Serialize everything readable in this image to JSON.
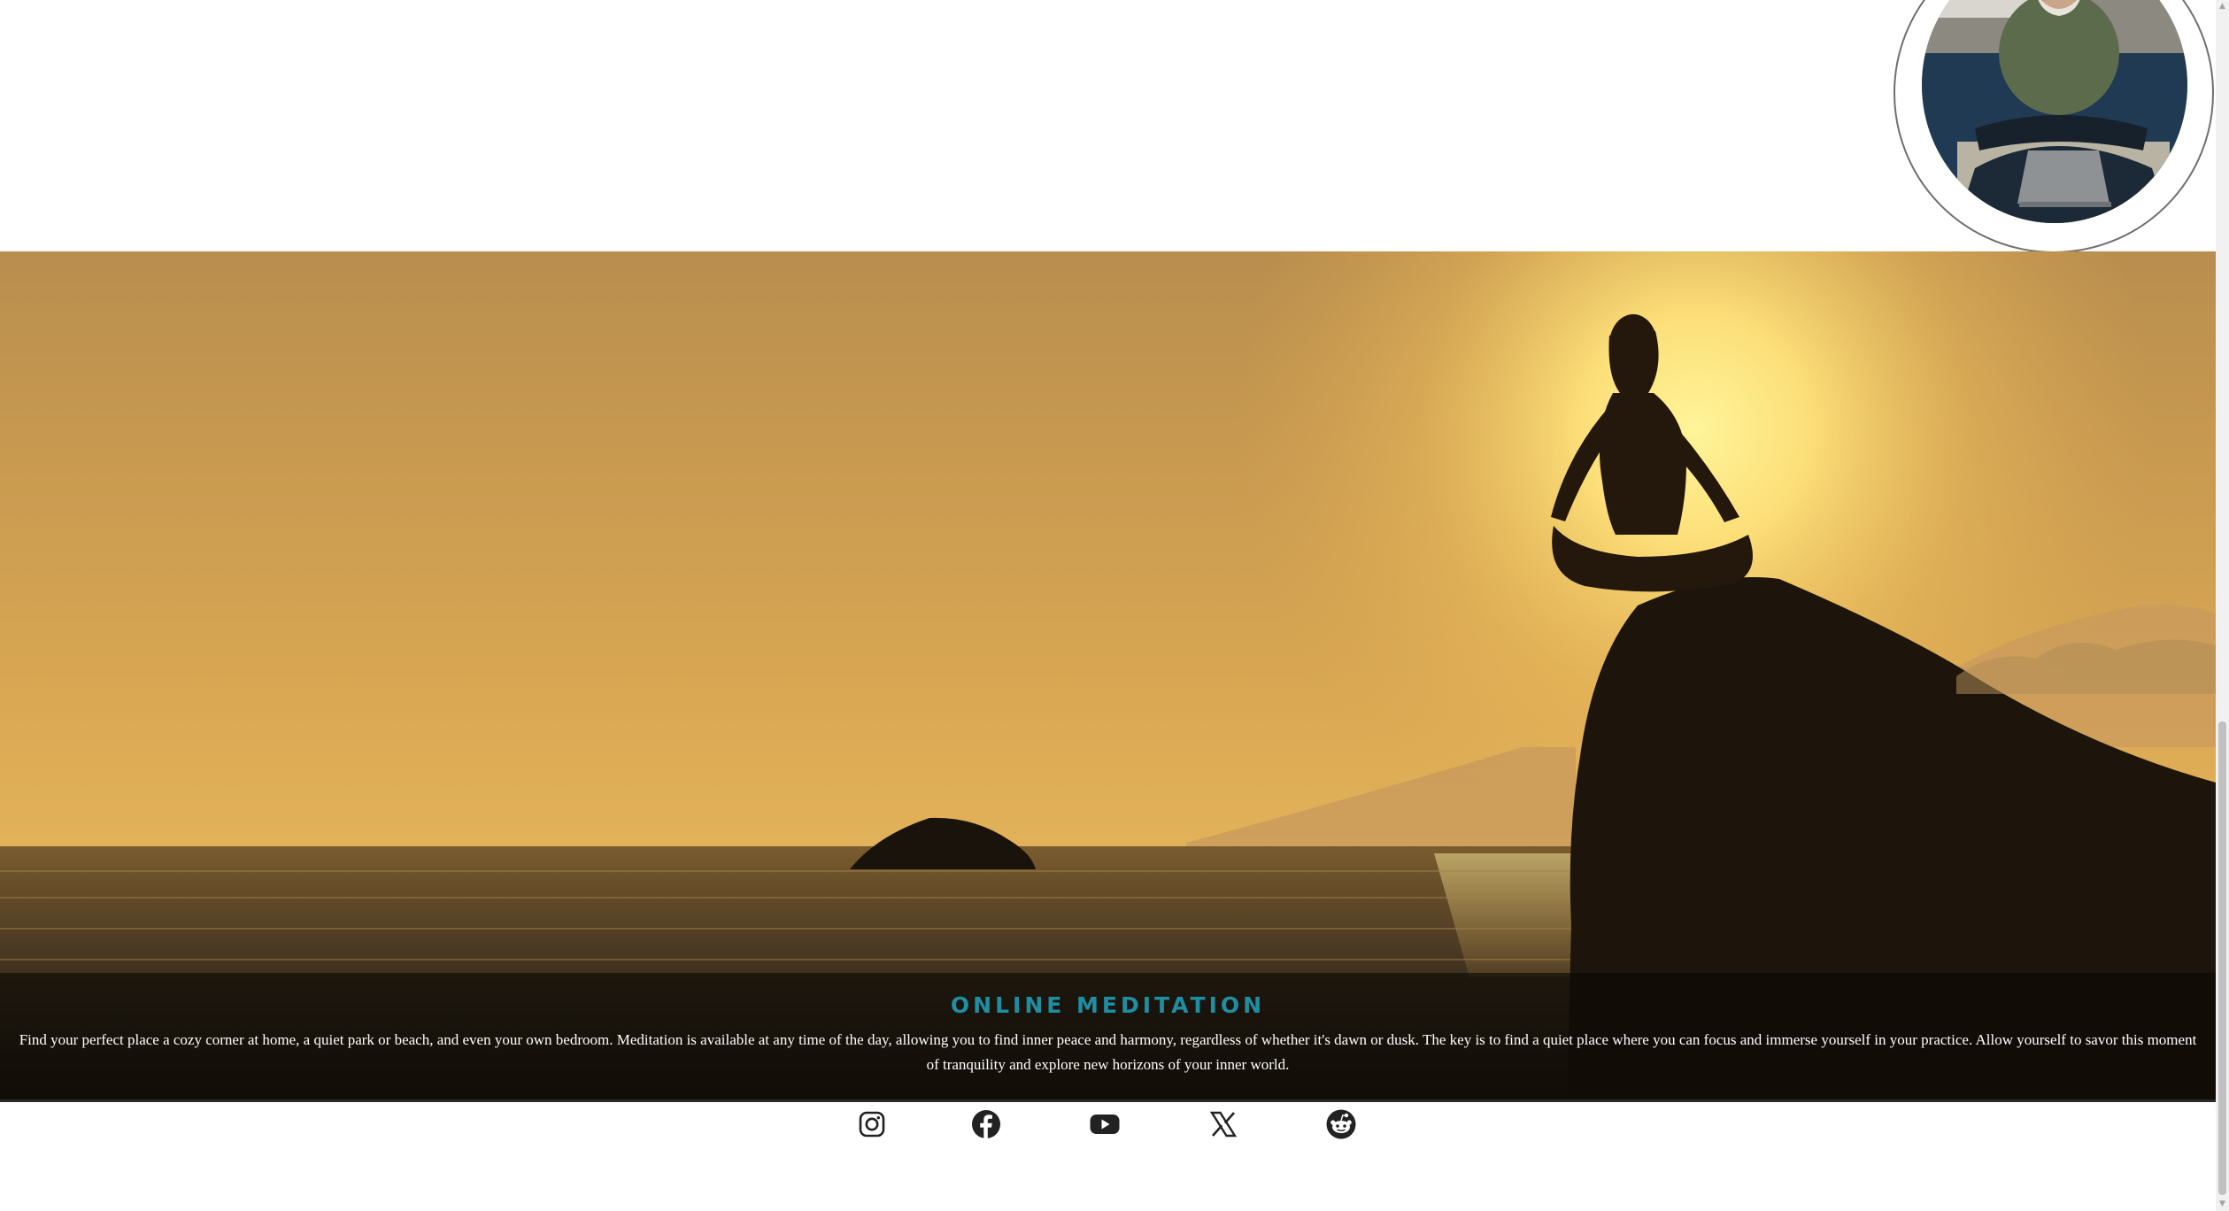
{
  "hero": {
    "title": "ONLINE MEDITATION",
    "text": "Find your perfect place a cozy corner at home, a quiet park or beach, and even your own bedroom. Meditation is available at any time of the day, allowing you to find inner peace and harmony, regardless of whether it's dawn or dusk. The key is to find a quiet place where you can focus and immerse yourself in your practice. Allow yourself to savor this moment of tranquility and explore new horizons of your inner world."
  },
  "social": [
    {
      "icon": "instagram-icon"
    },
    {
      "icon": "facebook-icon"
    },
    {
      "icon": "youtube-icon"
    },
    {
      "icon": "x-icon"
    },
    {
      "icon": "reddit-icon"
    }
  ],
  "colors": {
    "title_accent": "#1f8ea3",
    "caption_overlay": "rgba(10,8,4,0.62)",
    "sky": "#e4b257"
  }
}
